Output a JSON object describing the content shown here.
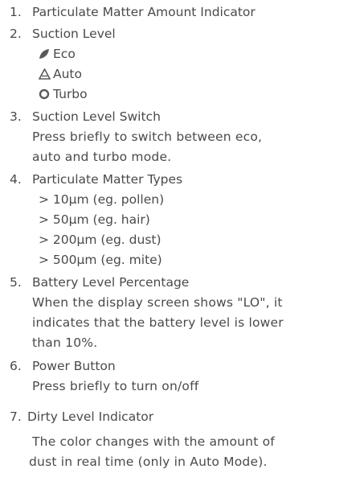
{
  "items": [
    {
      "num": "1.",
      "title": "Particulate Matter Amount Indicator"
    },
    {
      "num": "2.",
      "title": "Suction Level",
      "modes": [
        {
          "icon": "leaf-icon",
          "label": "Eco"
        },
        {
          "icon": "auto-triangle-icon",
          "label": "Auto"
        },
        {
          "icon": "turbo-ring-icon",
          "label": "Turbo"
        }
      ]
    },
    {
      "num": "3.",
      "title": "Suction Level Switch",
      "desc": [
        "Press briefly to switch between eco,",
        "auto and turbo mode."
      ]
    },
    {
      "num": "4.",
      "title": "Particulate Matter Types",
      "types": [
        "> 10μm (eg. pollen)",
        "> 50μm (eg. hair)",
        "> 200μm (eg. dust)",
        "> 500μm (eg. mite)"
      ]
    },
    {
      "num": "5.",
      "title": "Battery Level Percentage",
      "desc": [
        "When the display screen shows \"LO\", it",
        "indicates that the battery level is lower",
        "than 10%."
      ]
    },
    {
      "num": "6.",
      "title": "Power Button",
      "desc": [
        "Press briefly to turn on/off"
      ]
    },
    {
      "num": "7.",
      "title": "Dirty Level Indicator",
      "desc": [
        "The color changes with the amount of",
        "dust in real time (only in Auto Mode)."
      ]
    }
  ],
  "colors": {
    "text": "#4a4a4a",
    "icon": "#5a5a5a"
  }
}
